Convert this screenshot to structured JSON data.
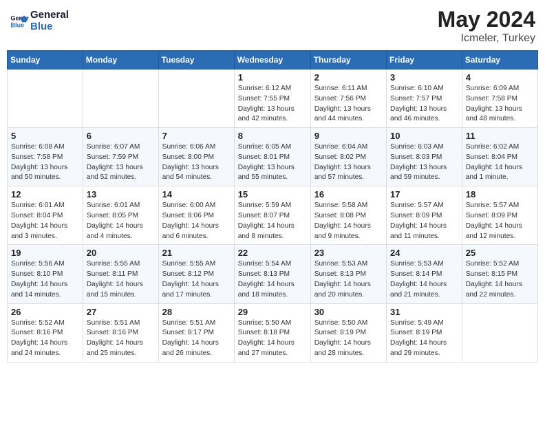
{
  "header": {
    "logo_text_general": "General",
    "logo_text_blue": "Blue",
    "month": "May 2024",
    "location": "Icmeler, Turkey"
  },
  "weekdays": [
    "Sunday",
    "Monday",
    "Tuesday",
    "Wednesday",
    "Thursday",
    "Friday",
    "Saturday"
  ],
  "weeks": [
    [
      {
        "day": null,
        "sunrise": null,
        "sunset": null,
        "daylight": null
      },
      {
        "day": null,
        "sunrise": null,
        "sunset": null,
        "daylight": null
      },
      {
        "day": null,
        "sunrise": null,
        "sunset": null,
        "daylight": null
      },
      {
        "day": "1",
        "sunrise": "Sunrise: 6:12 AM",
        "sunset": "Sunset: 7:55 PM",
        "daylight": "Daylight: 13 hours and 42 minutes."
      },
      {
        "day": "2",
        "sunrise": "Sunrise: 6:11 AM",
        "sunset": "Sunset: 7:56 PM",
        "daylight": "Daylight: 13 hours and 44 minutes."
      },
      {
        "day": "3",
        "sunrise": "Sunrise: 6:10 AM",
        "sunset": "Sunset: 7:57 PM",
        "daylight": "Daylight: 13 hours and 46 minutes."
      },
      {
        "day": "4",
        "sunrise": "Sunrise: 6:09 AM",
        "sunset": "Sunset: 7:58 PM",
        "daylight": "Daylight: 13 hours and 48 minutes."
      }
    ],
    [
      {
        "day": "5",
        "sunrise": "Sunrise: 6:08 AM",
        "sunset": "Sunset: 7:58 PM",
        "daylight": "Daylight: 13 hours and 50 minutes."
      },
      {
        "day": "6",
        "sunrise": "Sunrise: 6:07 AM",
        "sunset": "Sunset: 7:59 PM",
        "daylight": "Daylight: 13 hours and 52 minutes."
      },
      {
        "day": "7",
        "sunrise": "Sunrise: 6:06 AM",
        "sunset": "Sunset: 8:00 PM",
        "daylight": "Daylight: 13 hours and 54 minutes."
      },
      {
        "day": "8",
        "sunrise": "Sunrise: 6:05 AM",
        "sunset": "Sunset: 8:01 PM",
        "daylight": "Daylight: 13 hours and 55 minutes."
      },
      {
        "day": "9",
        "sunrise": "Sunrise: 6:04 AM",
        "sunset": "Sunset: 8:02 PM",
        "daylight": "Daylight: 13 hours and 57 minutes."
      },
      {
        "day": "10",
        "sunrise": "Sunrise: 6:03 AM",
        "sunset": "Sunset: 8:03 PM",
        "daylight": "Daylight: 13 hours and 59 minutes."
      },
      {
        "day": "11",
        "sunrise": "Sunrise: 6:02 AM",
        "sunset": "Sunset: 8:04 PM",
        "daylight": "Daylight: 14 hours and 1 minute."
      }
    ],
    [
      {
        "day": "12",
        "sunrise": "Sunrise: 6:01 AM",
        "sunset": "Sunset: 8:04 PM",
        "daylight": "Daylight: 14 hours and 3 minutes."
      },
      {
        "day": "13",
        "sunrise": "Sunrise: 6:01 AM",
        "sunset": "Sunset: 8:05 PM",
        "daylight": "Daylight: 14 hours and 4 minutes."
      },
      {
        "day": "14",
        "sunrise": "Sunrise: 6:00 AM",
        "sunset": "Sunset: 8:06 PM",
        "daylight": "Daylight: 14 hours and 6 minutes."
      },
      {
        "day": "15",
        "sunrise": "Sunrise: 5:59 AM",
        "sunset": "Sunset: 8:07 PM",
        "daylight": "Daylight: 14 hours and 8 minutes."
      },
      {
        "day": "16",
        "sunrise": "Sunrise: 5:58 AM",
        "sunset": "Sunset: 8:08 PM",
        "daylight": "Daylight: 14 hours and 9 minutes."
      },
      {
        "day": "17",
        "sunrise": "Sunrise: 5:57 AM",
        "sunset": "Sunset: 8:09 PM",
        "daylight": "Daylight: 14 hours and 11 minutes."
      },
      {
        "day": "18",
        "sunrise": "Sunrise: 5:57 AM",
        "sunset": "Sunset: 8:09 PM",
        "daylight": "Daylight: 14 hours and 12 minutes."
      }
    ],
    [
      {
        "day": "19",
        "sunrise": "Sunrise: 5:56 AM",
        "sunset": "Sunset: 8:10 PM",
        "daylight": "Daylight: 14 hours and 14 minutes."
      },
      {
        "day": "20",
        "sunrise": "Sunrise: 5:55 AM",
        "sunset": "Sunset: 8:11 PM",
        "daylight": "Daylight: 14 hours and 15 minutes."
      },
      {
        "day": "21",
        "sunrise": "Sunrise: 5:55 AM",
        "sunset": "Sunset: 8:12 PM",
        "daylight": "Daylight: 14 hours and 17 minutes."
      },
      {
        "day": "22",
        "sunrise": "Sunrise: 5:54 AM",
        "sunset": "Sunset: 8:13 PM",
        "daylight": "Daylight: 14 hours and 18 minutes."
      },
      {
        "day": "23",
        "sunrise": "Sunrise: 5:53 AM",
        "sunset": "Sunset: 8:13 PM",
        "daylight": "Daylight: 14 hours and 20 minutes."
      },
      {
        "day": "24",
        "sunrise": "Sunrise: 5:53 AM",
        "sunset": "Sunset: 8:14 PM",
        "daylight": "Daylight: 14 hours and 21 minutes."
      },
      {
        "day": "25",
        "sunrise": "Sunrise: 5:52 AM",
        "sunset": "Sunset: 8:15 PM",
        "daylight": "Daylight: 14 hours and 22 minutes."
      }
    ],
    [
      {
        "day": "26",
        "sunrise": "Sunrise: 5:52 AM",
        "sunset": "Sunset: 8:16 PM",
        "daylight": "Daylight: 14 hours and 24 minutes."
      },
      {
        "day": "27",
        "sunrise": "Sunrise: 5:51 AM",
        "sunset": "Sunset: 8:16 PM",
        "daylight": "Daylight: 14 hours and 25 minutes."
      },
      {
        "day": "28",
        "sunrise": "Sunrise: 5:51 AM",
        "sunset": "Sunset: 8:17 PM",
        "daylight": "Daylight: 14 hours and 26 minutes."
      },
      {
        "day": "29",
        "sunrise": "Sunrise: 5:50 AM",
        "sunset": "Sunset: 8:18 PM",
        "daylight": "Daylight: 14 hours and 27 minutes."
      },
      {
        "day": "30",
        "sunrise": "Sunrise: 5:50 AM",
        "sunset": "Sunset: 8:19 PM",
        "daylight": "Daylight: 14 hours and 28 minutes."
      },
      {
        "day": "31",
        "sunrise": "Sunrise: 5:49 AM",
        "sunset": "Sunset: 8:19 PM",
        "daylight": "Daylight: 14 hours and 29 minutes."
      },
      {
        "day": null,
        "sunrise": null,
        "sunset": null,
        "daylight": null
      }
    ]
  ]
}
